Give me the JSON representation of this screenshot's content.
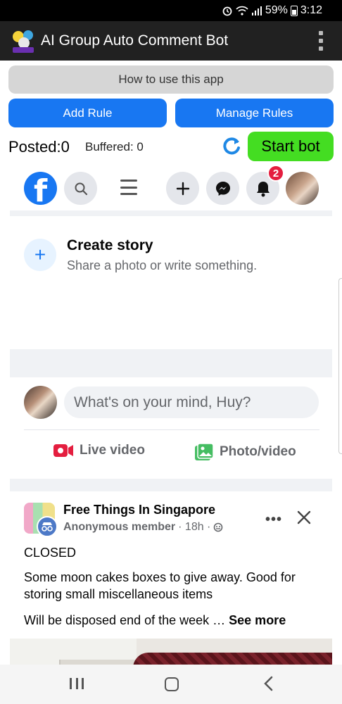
{
  "status_bar": {
    "battery": "59%",
    "time": "3:12"
  },
  "app": {
    "title": "AI Group Auto Comment Bot"
  },
  "controls": {
    "how_to": "How to use this app",
    "add_rule": "Add Rule",
    "manage_rules": "Manage Rules",
    "posted": "Posted:0",
    "buffered": "Buffered: 0",
    "start_bot": "Start bot"
  },
  "facebook": {
    "notification_count": "2",
    "story": {
      "title": "Create story",
      "subtitle": "Share a photo or write something."
    },
    "composer": {
      "placeholder": "What's on your mind, Huy?",
      "live_label": "Live video",
      "photo_label": "Photo/video"
    },
    "post": {
      "group_name": "Free Things In Singapore",
      "author": "Anonymous member",
      "time": "· 18h ·",
      "line1": "CLOSED",
      "line2": "Some moon cakes boxes to give away. Good for storing small miscellaneous items",
      "line3": "Will be disposed end of the week … ",
      "see_more": "See more"
    }
  },
  "colors": {
    "facebook_blue": "#1877f2",
    "start_green": "#44dd22",
    "notification_red": "#e41e3f"
  }
}
